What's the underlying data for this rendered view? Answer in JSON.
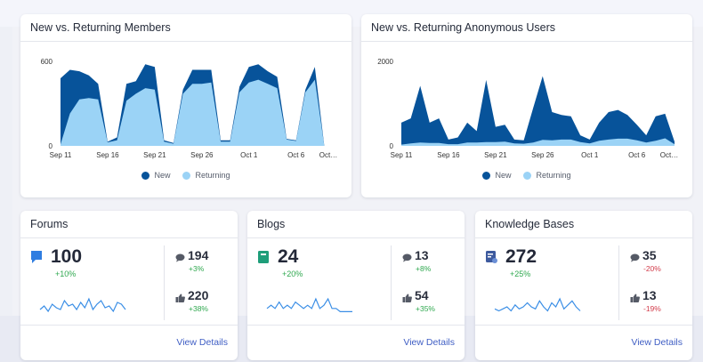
{
  "colors": {
    "new": "#07539a",
    "returning": "#9bd3f6",
    "positive": "#2fa84f",
    "negative": "#d23b4a",
    "link": "#3f5ec4"
  },
  "members_chart": {
    "title": "New vs. Returning Members",
    "legend": {
      "new": "New",
      "returning": "Returning"
    }
  },
  "anon_chart": {
    "title": "New vs. Returning Anonymous Users",
    "legend": {
      "new": "New",
      "returning": "Returning"
    }
  },
  "chart_data": [
    {
      "type": "area",
      "title": "New vs. Returning Members",
      "ylim": [
        0,
        600
      ],
      "yticks": [
        "0",
        "600"
      ],
      "xticks": [
        "Sep 11",
        "Sep 16",
        "Sep 21",
        "Sep 26",
        "Oct 1",
        "Oct 6",
        "Oct…"
      ],
      "x": [
        "Sep 11",
        "Sep 12",
        "Sep 13",
        "Sep 14",
        "Sep 15",
        "Sep 16",
        "Sep 17",
        "Sep 18",
        "Sep 19",
        "Sep 20",
        "Sep 21",
        "Sep 22",
        "Sep 23",
        "Sep 24",
        "Sep 25",
        "Sep 26",
        "Sep 27",
        "Sep 28",
        "Sep 29",
        "Sep 30",
        "Oct 1",
        "Oct 2",
        "Oct 3",
        "Oct 4",
        "Oct 5",
        "Oct 6",
        "Oct 7",
        "Oct 8",
        "Oct 9",
        "Oct 10"
      ],
      "series": [
        {
          "name": "New",
          "values": [
            480,
            540,
            530,
            500,
            440,
            30,
            60,
            440,
            460,
            580,
            560,
            40,
            20,
            400,
            540,
            540,
            540,
            40,
            40,
            420,
            560,
            580,
            530,
            490,
            50,
            40,
            400,
            560,
            0,
            0
          ]
        },
        {
          "name": "Returning",
          "values": [
            10,
            230,
            330,
            340,
            330,
            25,
            40,
            320,
            370,
            410,
            400,
            30,
            15,
            370,
            440,
            440,
            450,
            30,
            30,
            380,
            450,
            470,
            440,
            410,
            45,
            35,
            380,
            470,
            0,
            0
          ]
        }
      ]
    },
    {
      "type": "area",
      "title": "New vs. Returning Anonymous Users",
      "ylim": [
        0,
        2000
      ],
      "yticks": [
        "0",
        "2000"
      ],
      "xticks": [
        "Sep 11",
        "Sep 16",
        "Sep 21",
        "Sep 26",
        "Oct 1",
        "Oct 6",
        "Oct…"
      ],
      "x": [
        "Sep 11",
        "Sep 12",
        "Sep 13",
        "Sep 14",
        "Sep 15",
        "Sep 16",
        "Sep 17",
        "Sep 18",
        "Sep 19",
        "Sep 20",
        "Sep 21",
        "Sep 22",
        "Sep 23",
        "Sep 24",
        "Sep 25",
        "Sep 26",
        "Sep 27",
        "Sep 28",
        "Sep 29",
        "Sep 30",
        "Oct 1",
        "Oct 2",
        "Oct 3",
        "Oct 4",
        "Oct 5",
        "Oct 6",
        "Oct 7",
        "Oct 8",
        "Oct 9",
        "Oct 10"
      ],
      "series": [
        {
          "name": "New",
          "values": [
            550,
            650,
            1420,
            550,
            650,
            150,
            200,
            550,
            350,
            1560,
            450,
            500,
            150,
            130,
            900,
            1650,
            800,
            730,
            700,
            250,
            150,
            550,
            800,
            850,
            730,
            500,
            250,
            700,
            760,
            100
          ]
        },
        {
          "name": "Returning",
          "values": [
            30,
            60,
            80,
            70,
            70,
            40,
            40,
            80,
            80,
            90,
            90,
            100,
            60,
            50,
            80,
            140,
            130,
            150,
            150,
            90,
            60,
            120,
            150,
            170,
            170,
            130,
            80,
            120,
            180,
            40
          ]
        }
      ]
    }
  ],
  "stats": [
    {
      "title": "Forums",
      "icon": "chat-bubble-icon",
      "value": "100",
      "change": "+10%",
      "sub1": {
        "icon": "comment-icon",
        "value": "194",
        "change": "+3%",
        "trend": "pos"
      },
      "sub2": {
        "icon": "thumbs-up-icon",
        "value": "220",
        "change": "+38%",
        "trend": "pos"
      },
      "spark": [
        3,
        5,
        2,
        6,
        4,
        3,
        8,
        5,
        6,
        3,
        7,
        4,
        9,
        3,
        6,
        8,
        4,
        5,
        2,
        7,
        6,
        3
      ],
      "link": "View Details"
    },
    {
      "title": "Blogs",
      "icon": "book-icon",
      "value": "24",
      "change": "+20%",
      "sub1": {
        "icon": "comment-icon",
        "value": "13",
        "change": "+8%",
        "trend": "pos"
      },
      "sub2": {
        "icon": "thumbs-up-icon",
        "value": "54",
        "change": "+35%",
        "trend": "pos"
      },
      "spark": [
        2,
        3,
        2,
        4,
        2,
        3,
        2,
        4,
        3,
        2,
        3,
        2,
        5,
        2,
        3,
        5,
        2,
        2,
        1,
        1,
        1,
        1
      ],
      "link": "View Details"
    },
    {
      "title": "Knowledge Bases",
      "icon": "kb-icon",
      "value": "272",
      "change": "+25%",
      "sub1": {
        "icon": "comment-icon",
        "value": "35",
        "change": "-20%",
        "trend": "neg"
      },
      "sub2": {
        "icon": "thumbs-up-icon",
        "value": "13",
        "change": "-19%",
        "trend": "neg"
      },
      "spark": [
        3,
        2,
        3,
        4,
        2,
        5,
        3,
        4,
        6,
        4,
        3,
        7,
        4,
        2,
        6,
        4,
        8,
        3,
        5,
        7,
        4,
        2
      ],
      "link": "View Details"
    }
  ]
}
